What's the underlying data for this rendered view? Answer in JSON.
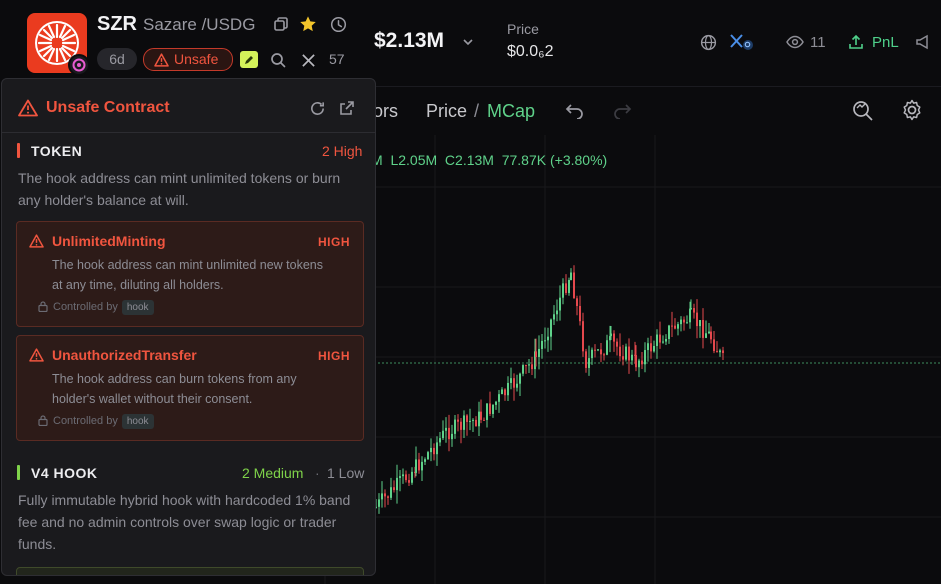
{
  "header": {
    "symbol": "SZR",
    "name": "Sazare /USDG",
    "age": "6d",
    "unsafe_label": "Unsafe",
    "x_count": "57",
    "market_cap": "$2.13M",
    "price_label": "Price",
    "price_value": "$0.0₆₈₂",
    "price_display": "$0.0₆2",
    "watchers": "11",
    "pnl_label": "PnL"
  },
  "chart": {
    "toolbar": {
      "indicators_partial": "ors",
      "price_label": "Price",
      "separator": "/",
      "mcap_label": "MCap"
    },
    "ohlc_text": "M  L2.05M  C2.13M  77.87K (+3.80%)"
  },
  "popup": {
    "title": "Unsafe Contract",
    "token_section": {
      "title": "TOKEN",
      "count": "2 High",
      "desc_line1": "The hook address can mint unlimited tokens or burn",
      "desc_line2": "any holder's balance at will."
    },
    "risks": [
      {
        "name": "UnlimitedMinting",
        "level": "HIGH",
        "desc_line1": "The hook address can mint unlimited new tokens",
        "desc_line2": "at any time, diluting all holders.",
        "controlled_label": "Controlled by",
        "tag": "hook"
      },
      {
        "name": "UnauthorizedTransfer",
        "level": "HIGH",
        "desc_line1": "The hook address can burn tokens from any",
        "desc_line2": "holder's wallet without their consent.",
        "controlled_label": "Controlled by",
        "tag": "hook"
      }
    ],
    "hook_section": {
      "title": "V4 HOOK",
      "count_medium": "2 Medium",
      "separator": "·",
      "count_low": "1 Low",
      "desc_line1": "Fully immutable hybrid hook with hardcoded 1% band",
      "desc_line2": "fee and no admin controls over swap logic or trader",
      "desc_line3": "funds."
    }
  },
  "colors": {
    "accent_red": "#f0553f",
    "up_green": "#5fd28a",
    "down_red": "#e5484d",
    "medium_green": "#7fd34a"
  }
}
